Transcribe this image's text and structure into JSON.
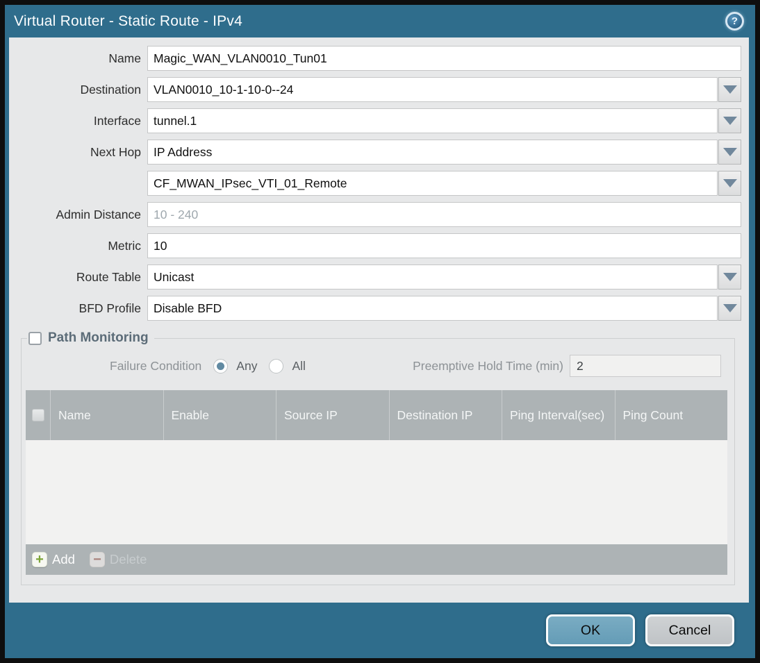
{
  "window": {
    "title": "Virtual Router - Static Route - IPv4"
  },
  "form": {
    "name": {
      "label": "Name",
      "value": "Magic_WAN_VLAN0010_Tun01"
    },
    "destination": {
      "label": "Destination",
      "value": "VLAN0010_10-1-10-0--24"
    },
    "interface": {
      "label": "Interface",
      "value": "tunnel.1"
    },
    "next_hop": {
      "label": "Next Hop",
      "value": "IP Address"
    },
    "next_hop_address": {
      "value": "CF_MWAN_IPsec_VTI_01_Remote"
    },
    "admin_distance": {
      "label": "Admin Distance",
      "value": "",
      "placeholder": "10 - 240"
    },
    "metric": {
      "label": "Metric",
      "value": "10"
    },
    "route_table": {
      "label": "Route Table",
      "value": "Unicast"
    },
    "bfd_profile": {
      "label": "BFD Profile",
      "value": "Disable BFD"
    }
  },
  "path_monitoring": {
    "title": "Path Monitoring",
    "enabled": false,
    "failure_condition_label": "Failure Condition",
    "options": [
      {
        "label": "Any",
        "selected": true
      },
      {
        "label": "All",
        "selected": false
      }
    ],
    "preemptive_hold_time": {
      "label": "Preemptive Hold Time (min)",
      "value": "2"
    },
    "table": {
      "columns": [
        "Name",
        "Enable",
        "Source IP",
        "Destination IP",
        "Ping Interval(sec)",
        "Ping Count"
      ],
      "rows": [],
      "add_label": "Add",
      "delete_label": "Delete"
    }
  },
  "footer": {
    "ok_label": "OK",
    "cancel_label": "Cancel"
  },
  "colors": {
    "frame_teal": "#2f6d8c",
    "content_bg": "#e7e8e9",
    "table_header_gray": "#adb3b5",
    "ok_button_blue": "#6ca3bc",
    "add_icon_green": "#7ca438"
  }
}
